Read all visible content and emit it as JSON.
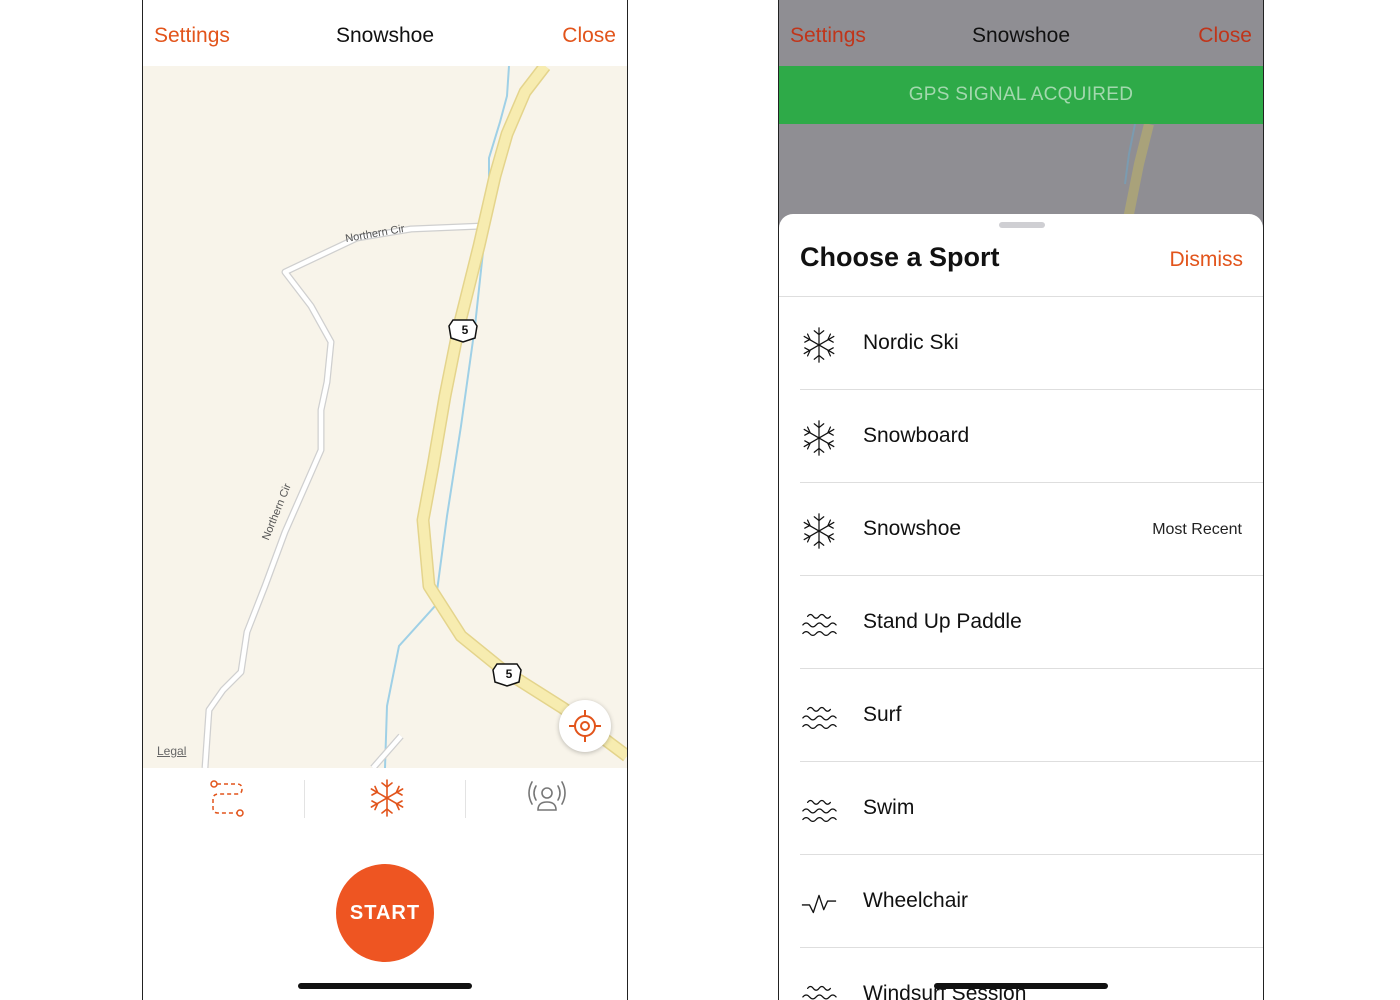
{
  "left_screen": {
    "nav": {
      "settings_label": "Settings",
      "title": "Snowshoe",
      "close_label": "Close"
    },
    "map": {
      "road_labels": [
        "Northern Cir",
        "Northern Cir"
      ],
      "route_shield_number": "5",
      "legal_label": "Legal"
    },
    "toolbar": {
      "items": [
        {
          "icon": "route-icon"
        },
        {
          "icon": "snowflake-icon"
        },
        {
          "icon": "beacon-icon"
        }
      ]
    },
    "start_label": "START"
  },
  "right_screen": {
    "nav": {
      "settings_label": "Settings",
      "title": "Snowshoe",
      "close_label": "Close"
    },
    "gps_banner": "GPS SIGNAL ACQUIRED",
    "sheet": {
      "title": "Choose a Sport",
      "dismiss_label": "Dismiss",
      "sports": [
        {
          "label": "Nordic Ski",
          "icon": "snowflake-icon",
          "badge": ""
        },
        {
          "label": "Snowboard",
          "icon": "snowflake-icon",
          "badge": ""
        },
        {
          "label": "Snowshoe",
          "icon": "snowflake-icon",
          "badge": "Most Recent"
        },
        {
          "label": "Stand Up Paddle",
          "icon": "waves-icon",
          "badge": ""
        },
        {
          "label": "Surf",
          "icon": "waves-icon",
          "badge": ""
        },
        {
          "label": "Swim",
          "icon": "waves-icon",
          "badge": ""
        },
        {
          "label": "Wheelchair",
          "icon": "heartbeat-icon",
          "badge": ""
        },
        {
          "label": "Windsurf Session",
          "icon": "waves-icon",
          "badge": ""
        }
      ]
    }
  },
  "colors": {
    "accent": "#e2541b",
    "start_button": "#ee5522",
    "gps_banner": "#2eaa48",
    "map_background": "#f8f4ea",
    "highway": "#f7ecb0",
    "water": "#9fd0e6",
    "dim_overlay": "#8f8e93"
  }
}
